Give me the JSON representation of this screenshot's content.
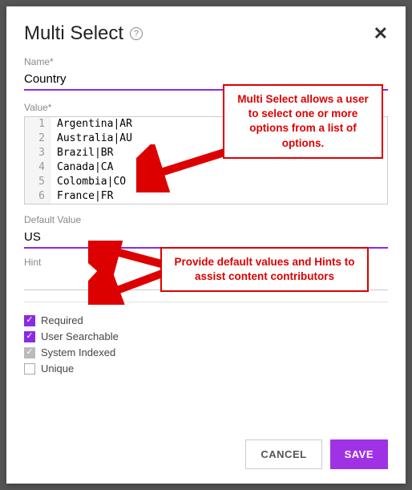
{
  "header": {
    "title": "Multi Select",
    "help_glyph": "?",
    "close_glyph": "✕"
  },
  "fields": {
    "name_label": "Name*",
    "name_value": "Country",
    "value_label": "Value*",
    "value_lines": [
      "Argentina|AR",
      "Australia|AU",
      "Brazil|BR",
      "Canada|CA",
      "Colombia|CO",
      "France|FR"
    ],
    "default_label": "Default Value",
    "default_value": "US",
    "hint_label": "Hint",
    "hint_value": ""
  },
  "checks": {
    "required": {
      "label": "Required",
      "checked": true,
      "style": "purple"
    },
    "searchable": {
      "label": "User Searchable",
      "checked": true,
      "style": "purple"
    },
    "indexed": {
      "label": "System Indexed",
      "checked": true,
      "style": "grey"
    },
    "unique": {
      "label": "Unique",
      "checked": false,
      "style": "none"
    }
  },
  "buttons": {
    "cancel": "CANCEL",
    "save": "SAVE"
  },
  "annotations": {
    "callout1": "Multi Select allows a user to select one or more options from a list of options.",
    "callout2": "Provide default values and Hints to assist content contributors"
  }
}
